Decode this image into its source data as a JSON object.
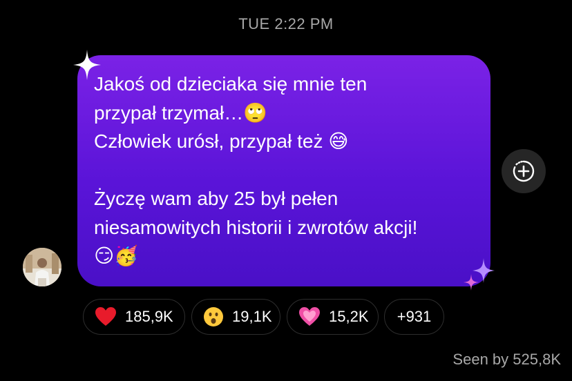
{
  "thread": {
    "timestamp": "TUE 2:22 PM"
  },
  "message": {
    "text": "Jakoś od dzieciaka się mnie ten\nprzypał trzymał…🙄\nCzłowiek urósł, przypał też 😅\n\nŻyczę wam aby 25 był pełen\nniesamowitych historii i zwrotów akcji!\n😏🥳",
    "bubble_gradient": [
      "#7b22e6",
      "#4a10c7"
    ]
  },
  "share_button": {
    "icon": "add-circle-dashed-icon"
  },
  "reactions": [
    {
      "icon": "red-heart-emoji",
      "count": "185,9K"
    },
    {
      "icon": "surprised-face-emoji",
      "count": "19,1K"
    },
    {
      "icon": "pink-heart-emoji",
      "count": "15,2K"
    },
    {
      "icon": "",
      "count": "+931"
    }
  ],
  "seen": {
    "label": "Seen by 525,8K"
  },
  "colors": {
    "background": "#000000",
    "muted_text": "#a8a8a8",
    "pill_border": "#2e2e2e",
    "share_bg": "#262626"
  }
}
